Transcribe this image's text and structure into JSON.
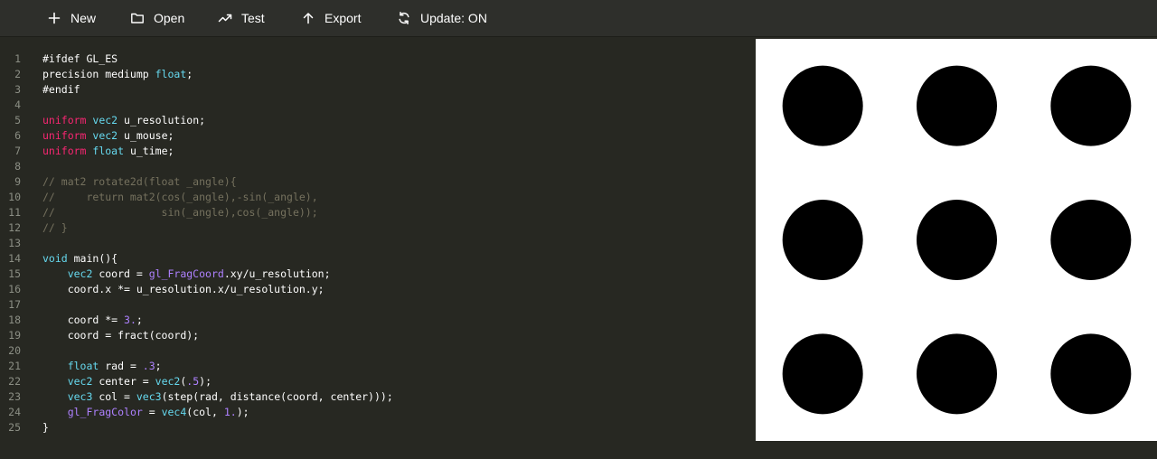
{
  "toolbar": {
    "buttons": [
      {
        "id": "new",
        "label": "New",
        "icon": "plus-icon"
      },
      {
        "id": "open",
        "label": "Open",
        "icon": "folder-icon"
      },
      {
        "id": "test",
        "label": "Test",
        "icon": "trend-line-icon"
      },
      {
        "id": "export",
        "label": "Export",
        "icon": "arrow-up-icon"
      },
      {
        "id": "update",
        "label": "Update: ON",
        "icon": "refresh-icon"
      }
    ]
  },
  "editor": {
    "lines": [
      {
        "n": "1",
        "tokens": [
          {
            "t": "#ifdef GL_ES",
            "k": "plain"
          }
        ]
      },
      {
        "n": "2",
        "tokens": [
          {
            "t": "precision mediump ",
            "k": "plain"
          },
          {
            "t": "float",
            "k": "type"
          },
          {
            "t": ";",
            "k": "plain"
          }
        ]
      },
      {
        "n": "3",
        "tokens": [
          {
            "t": "#endif",
            "k": "plain"
          }
        ]
      },
      {
        "n": "4",
        "tokens": []
      },
      {
        "n": "5",
        "tokens": [
          {
            "t": "uniform",
            "k": "keyword"
          },
          {
            "t": " ",
            "k": "plain"
          },
          {
            "t": "vec2",
            "k": "type"
          },
          {
            "t": " u_resolution;",
            "k": "plain"
          }
        ]
      },
      {
        "n": "6",
        "tokens": [
          {
            "t": "uniform",
            "k": "keyword"
          },
          {
            "t": " ",
            "k": "plain"
          },
          {
            "t": "vec2",
            "k": "type"
          },
          {
            "t": " u_mouse;",
            "k": "plain"
          }
        ]
      },
      {
        "n": "7",
        "tokens": [
          {
            "t": "uniform",
            "k": "keyword"
          },
          {
            "t": " ",
            "k": "plain"
          },
          {
            "t": "float",
            "k": "type"
          },
          {
            "t": " u_time;",
            "k": "plain"
          }
        ]
      },
      {
        "n": "8",
        "tokens": []
      },
      {
        "n": "9",
        "tokens": [
          {
            "t": "// mat2 rotate2d(float _angle){",
            "k": "comment"
          }
        ]
      },
      {
        "n": "10",
        "tokens": [
          {
            "t": "//     return mat2(cos(_angle),-sin(_angle),",
            "k": "comment"
          }
        ]
      },
      {
        "n": "11",
        "tokens": [
          {
            "t": "//                 sin(_angle),cos(_angle));",
            "k": "comment"
          }
        ]
      },
      {
        "n": "12",
        "tokens": [
          {
            "t": "// }",
            "k": "comment"
          }
        ]
      },
      {
        "n": "13",
        "tokens": []
      },
      {
        "n": "14",
        "tokens": [
          {
            "t": "void",
            "k": "type"
          },
          {
            "t": " main(){",
            "k": "plain"
          }
        ]
      },
      {
        "n": "15",
        "tokens": [
          {
            "t": "    ",
            "k": "plain"
          },
          {
            "t": "vec2",
            "k": "type"
          },
          {
            "t": " coord = ",
            "k": "plain"
          },
          {
            "t": "gl_FragCoord",
            "k": "builtin"
          },
          {
            "t": ".xy/u_resolution;",
            "k": "plain"
          }
        ]
      },
      {
        "n": "16",
        "tokens": [
          {
            "t": "    coord.x *= u_resolution.x/u_resolution.y;",
            "k": "plain"
          }
        ]
      },
      {
        "n": "17",
        "tokens": []
      },
      {
        "n": "18",
        "tokens": [
          {
            "t": "    coord *= ",
            "k": "plain"
          },
          {
            "t": "3.",
            "k": "number"
          },
          {
            "t": ";",
            "k": "plain"
          }
        ]
      },
      {
        "n": "19",
        "tokens": [
          {
            "t": "    coord = fract(coord);",
            "k": "plain"
          }
        ]
      },
      {
        "n": "20",
        "tokens": []
      },
      {
        "n": "21",
        "tokens": [
          {
            "t": "    ",
            "k": "plain"
          },
          {
            "t": "float",
            "k": "type"
          },
          {
            "t": " rad = ",
            "k": "plain"
          },
          {
            "t": ".3",
            "k": "number"
          },
          {
            "t": ";",
            "k": "plain"
          }
        ]
      },
      {
        "n": "22",
        "tokens": [
          {
            "t": "    ",
            "k": "plain"
          },
          {
            "t": "vec2",
            "k": "type"
          },
          {
            "t": " center = ",
            "k": "plain"
          },
          {
            "t": "vec2",
            "k": "type"
          },
          {
            "t": "(",
            "k": "plain"
          },
          {
            "t": ".5",
            "k": "number"
          },
          {
            "t": ");",
            "k": "plain"
          }
        ]
      },
      {
        "n": "23",
        "tokens": [
          {
            "t": "    ",
            "k": "plain"
          },
          {
            "t": "vec3",
            "k": "type"
          },
          {
            "t": " col = ",
            "k": "plain"
          },
          {
            "t": "vec3",
            "k": "type"
          },
          {
            "t": "(step(rad, distance(coord, center)));",
            "k": "plain"
          }
        ]
      },
      {
        "n": "24",
        "tokens": [
          {
            "t": "    ",
            "k": "plain"
          },
          {
            "t": "gl_FragColor",
            "k": "builtin"
          },
          {
            "t": " = ",
            "k": "plain"
          },
          {
            "t": "vec4",
            "k": "type"
          },
          {
            "t": "(col, ",
            "k": "plain"
          },
          {
            "t": "1.",
            "k": "number"
          },
          {
            "t": ");",
            "k": "plain"
          }
        ]
      },
      {
        "n": "25",
        "tokens": [
          {
            "t": "}",
            "k": "plain"
          }
        ]
      }
    ]
  },
  "preview": {
    "grid_rows": 3,
    "grid_cols": 3,
    "radius_fraction": 0.3,
    "background_color": "#ffffff",
    "dot_color": "#000000"
  },
  "colors": {
    "editor_background": "#272822",
    "toolbar_background": "#2e2f2b",
    "keyword": "#f92672",
    "type": "#66d9ef",
    "number": "#ae81ff",
    "comment": "#75715e"
  }
}
